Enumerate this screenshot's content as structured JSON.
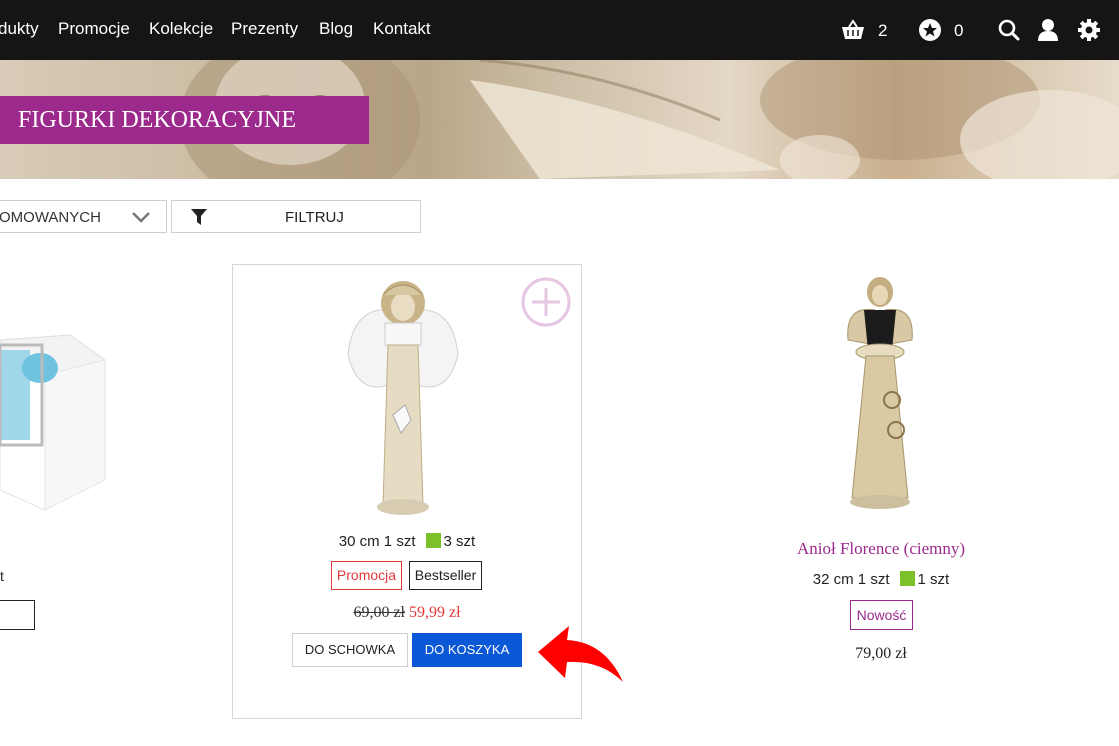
{
  "nav": {
    "items": [
      "dukty",
      "Promocje",
      "Kolekcje",
      "Prezenty",
      "Blog",
      "Kontakt"
    ],
    "cart_count": "2",
    "favorites_count": "0"
  },
  "banner": {
    "title": "FIGURKI DEKORACYJNE"
  },
  "toolbar": {
    "sort_value": "OMOWANYCH",
    "filter_label": "FILTRUJ"
  },
  "left_product": {
    "text_fragment": "t"
  },
  "products": [
    {
      "size": "30 cm 1 szt",
      "stock": "3 szt",
      "badges": [
        "Promocja",
        "Bestseller"
      ],
      "old_price": "69,00 zł",
      "price": "59,99 zł",
      "btn_wishlist": "DO SCHOWKA",
      "btn_cart": "DO KOSZYKA"
    },
    {
      "name": "Anioł Florence (ciemny)",
      "size": "32 cm 1 szt",
      "stock": "1 szt",
      "badge": "Nowość",
      "price": "79,00 zł"
    }
  ],
  "colors": {
    "nav_bg": "#151515",
    "brand_purple": "#9c2a8c",
    "promo_red": "#e23a3a",
    "cart_blue": "#0a58d6",
    "stock_green": "#7cc02a",
    "arrow_red": "#ff0000"
  },
  "icons": [
    "basket-icon",
    "star-circle-icon",
    "search-icon",
    "user-icon",
    "gear-icon",
    "chevron-down-icon",
    "funnel-icon",
    "plus-circle-icon",
    "curved-arrow-icon"
  ]
}
